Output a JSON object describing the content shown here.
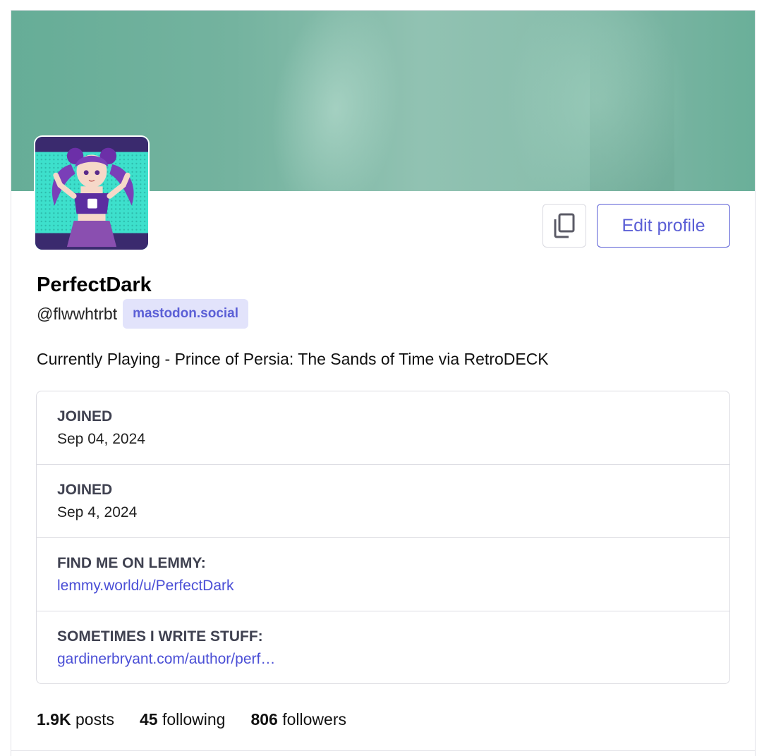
{
  "profile": {
    "display_name": "PerfectDark",
    "acct": "@flwwhtrbt",
    "domain": "mastodon.social",
    "bio": "Currently Playing - Prince of Persia: The Sands of Time via RetroDECK"
  },
  "actions": {
    "edit_label": "Edit profile",
    "copy_icon": "copy-icon"
  },
  "fields": [
    {
      "name": "JOINED",
      "value": "Sep 04, 2024"
    },
    {
      "name": "JOINED",
      "value": "Sep 4, 2024"
    },
    {
      "name": "FIND ME ON LEMMY:",
      "value": "lemmy.world/u/PerfectDark"
    },
    {
      "name": "SOMETIMES I WRITE STUFF:",
      "value": "gardinerbryant.com/author/perf…"
    }
  ],
  "stats": {
    "posts_count": "1.9K",
    "posts_label": "posts",
    "following_count": "45",
    "following_label": "following",
    "followers_count": "806",
    "followers_label": "followers"
  },
  "colors": {
    "accent": "#5b5fd6",
    "link": "#4b4fd6",
    "badge_bg": "#e2e3fb",
    "header_teal": "#74b39f"
  }
}
